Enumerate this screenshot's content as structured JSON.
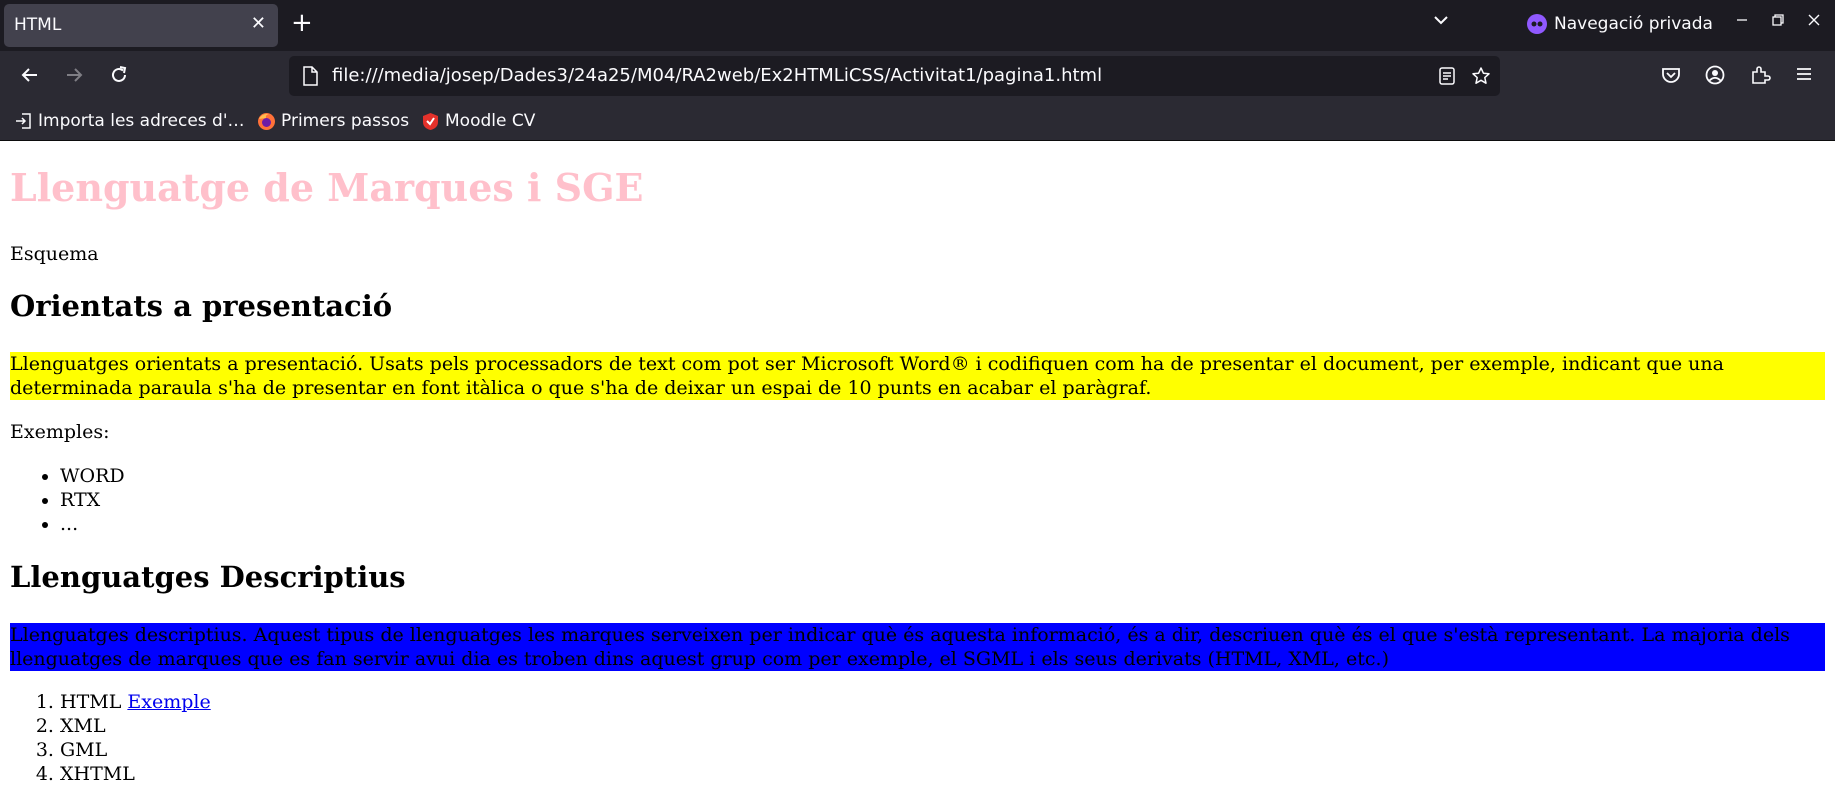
{
  "browser": {
    "tab_title": "HTML",
    "private_label": "Navegació privada",
    "url": "file:///media/josep/Dades3/24a25/M04/RA2web/Ex2HTMLiCSS/Activitat1/pagina1.html",
    "bookmarks": [
      {
        "label": "Importa les adreces d'…",
        "icon": "import-icon"
      },
      {
        "label": "Primers passos",
        "icon": "firefox-icon"
      },
      {
        "label": "Moodle CV",
        "icon": "moodle-icon"
      }
    ],
    "colors": {
      "tabbar": "#1c1b22",
      "toolbar": "#2b2a33",
      "active_tab": "#42414d",
      "private_accent": "#9059ff"
    }
  },
  "page": {
    "title": "Llenguatge de Marques i SGE",
    "subtitle": "Esquema",
    "section1": {
      "heading": "Orientats a presentació",
      "paragraph": "Llenguatges orientats a presentació. Usats pels processadors de text com pot ser Microsoft Word® i codifiquen com ha de presentar el document, per exemple, indicant que una determinada paraula s'ha de presentar en font itàlica o que s'ha de deixar un espai de 10 punts en acabar el paràgraf.",
      "examples_label": "Exemples:",
      "examples": [
        "WORD",
        "RTX",
        "..."
      ]
    },
    "section2": {
      "heading": "Llenguatges Descriptius",
      "paragraph": "Llenguatges descriptius. Aquest tipus de llenguatges les marques serveixen per indicar què és aquesta informació, és a dir, descriuen què és el que s'està representant. La majoria dels llenguatges de marques que es fan servir avui dia es troben dins aquest grup com per exemple, el SGML i els seus derivats (HTML, XML, etc.)",
      "items": [
        {
          "text": "HTML",
          "link": "Exemple"
        },
        {
          "text": "XML"
        },
        {
          "text": "GML"
        },
        {
          "text": "XHTML"
        }
      ]
    },
    "colors": {
      "title": "#ffc0cb",
      "highlight_yellow": "#ffff00",
      "highlight_blue": "#0000ff",
      "link": "#0000ee"
    }
  }
}
